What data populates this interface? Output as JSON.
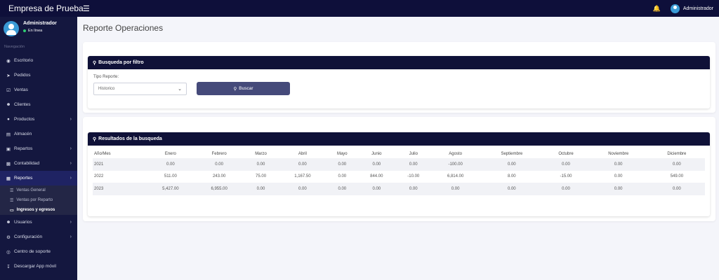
{
  "app": {
    "brand": "Empresa de Prueba",
    "top_user": "Administrador"
  },
  "sidebar": {
    "user_name": "Administrador",
    "user_status": "En línea",
    "nav_header": "Navegación",
    "items": [
      {
        "label": "Escritorio",
        "icon": "dashboard-icon"
      },
      {
        "label": "Pedidos",
        "icon": "paper-plane-icon"
      },
      {
        "label": "Ventas",
        "icon": "check-square-icon"
      },
      {
        "label": "Clientes",
        "icon": "users-icon"
      },
      {
        "label": "Productos",
        "icon": "cube-icon"
      },
      {
        "label": "Almacén",
        "icon": "file-icon"
      },
      {
        "label": "Repartos",
        "icon": "truck-icon"
      },
      {
        "label": "Contabilidad",
        "icon": "money-icon"
      },
      {
        "label": "Reportes",
        "icon": "chart-icon"
      },
      {
        "label": "Usuarios",
        "icon": "user-icon"
      },
      {
        "label": "Configuración",
        "icon": "gears-icon"
      },
      {
        "label": "Centro de soporte",
        "icon": "support-icon"
      },
      {
        "label": "Descargar App móvil",
        "icon": "download-icon"
      }
    ],
    "reportes_sub": [
      {
        "label": "Ventas General"
      },
      {
        "label": "Ventas por Reparto"
      },
      {
        "label": "Ingresos y egresos"
      }
    ]
  },
  "page": {
    "title": "Reporte Operaciones"
  },
  "filter": {
    "heading": "Busqueda por filtro",
    "label": "Tipo Reporte:",
    "selected": "Historico",
    "button": "Buscar"
  },
  "results": {
    "heading": "Resultados de la busqueda",
    "columns": [
      "Año/Mes",
      "Enero",
      "Febrero",
      "Marzo",
      "Abril",
      "Mayo",
      "Junio",
      "Julio",
      "Agosto",
      "Septiembre",
      "Octubre",
      "Noviembre",
      "Diciembre"
    ],
    "rows": [
      [
        "2021",
        "0.00",
        "0.00",
        "0.00",
        "0.00",
        "0.00",
        "0.00",
        "0.00",
        "-100.00",
        "0.00",
        "0.00",
        "0.00",
        "0.00"
      ],
      [
        "2022",
        "511.00",
        "243.00",
        "75.00",
        "1,167.50",
        "0.00",
        "844.00",
        "-10.00",
        "6,814.00",
        "8.00",
        "-15.00",
        "0.00",
        "549.00"
      ],
      [
        "2023",
        "5,427.00",
        "6,955.00",
        "0.00",
        "0.00",
        "0.00",
        "0.00",
        "0.00",
        "0.00",
        "0.00",
        "0.00",
        "0.00",
        "0.00"
      ]
    ]
  }
}
